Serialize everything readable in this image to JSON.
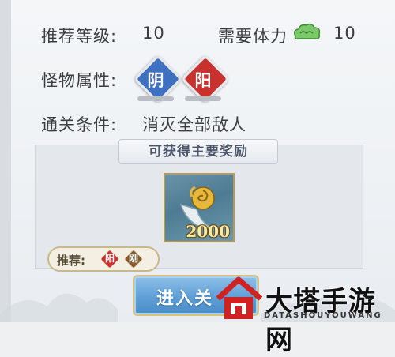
{
  "stage_info": {
    "recommended_level_label": "推荐等级:",
    "recommended_level_value": "10",
    "stamina_label": "需要体力",
    "stamina_icon": "cloud-stamina-icon",
    "stamina_value": "10",
    "monster_attr_label": "怪物属性:",
    "monster_attrs": [
      {
        "text": "阴",
        "color": "#3f6fbf"
      },
      {
        "text": "阳",
        "color": "#c8312e"
      }
    ],
    "clear_condition_label": "通关条件:",
    "clear_condition_value": "消灭全部敌人"
  },
  "rewards": {
    "title": "可获得主要奖励",
    "items": [
      {
        "icon": "jade-horn-icon",
        "quantity": "2000"
      }
    ]
  },
  "recommend": {
    "label": "推荐:",
    "attrs": [
      {
        "text": "阳",
        "color": "#c8312e"
      },
      {
        "text": "刚",
        "color": "#8a5a2b"
      }
    ]
  },
  "enter_button": {
    "label": "进入关"
  },
  "watermark": {
    "text": "大塔手游网",
    "sub": "DATASHOUYOUWANG"
  },
  "colors": {
    "yin": "#3f6fbf",
    "yang": "#c8312e",
    "gang": "#8a5a2b",
    "button": "#5f9fd6",
    "gold_border": "#d9c27b"
  }
}
